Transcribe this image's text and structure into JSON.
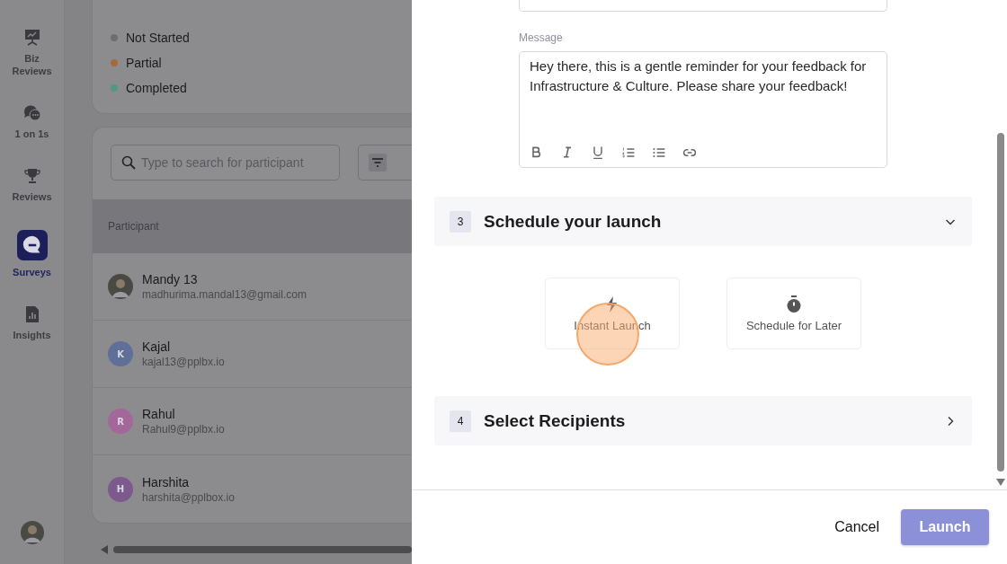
{
  "sidebar": {
    "items": [
      {
        "label": "Biz Reviews",
        "selected": false
      },
      {
        "label": "1 on 1s",
        "selected": false
      },
      {
        "label": "Reviews",
        "selected": false
      },
      {
        "label": "Surveys",
        "selected": true
      },
      {
        "label": "Insights",
        "selected": false
      }
    ]
  },
  "legend": [
    {
      "label": "Not Started",
      "color": "#6e6e72"
    },
    {
      "label": "Partial",
      "color": "#a8693a"
    },
    {
      "label": "Completed",
      "color": "#4f9a80"
    }
  ],
  "participants": {
    "search": {
      "placeholder": "Type to search for participant"
    },
    "columns": [
      "Participant"
    ],
    "rows": [
      {
        "name": "Mandy 13",
        "email": "madhurima.mandal13@gmail.com",
        "avatar": {
          "kind": "photo"
        }
      },
      {
        "name": "Kajal",
        "email": "kajal13@pplbx.io",
        "avatar": {
          "kind": "initial",
          "initial": "K",
          "color": "#5f6f98"
        }
      },
      {
        "name": "Rahul",
        "email": "Rahul9@pplbx.io",
        "avatar": {
          "kind": "initial",
          "initial": "R",
          "color": "#a3679a"
        }
      },
      {
        "name": "Harshita",
        "email": "harshita@pplbox.io",
        "avatar": {
          "kind": "initial",
          "initial": "H",
          "color": "#7d5a8e"
        }
      }
    ]
  },
  "drawer": {
    "message": {
      "label": "Message",
      "value": "Hey there, this is a gentle reminder for your feedback for Infrastructure & Culture. Please share your feedback!"
    },
    "sections": [
      {
        "number": "3",
        "title": "Schedule your launch",
        "expanded": true,
        "options": [
          {
            "label": "Instant Launch"
          },
          {
            "label": "Schedule for Later"
          }
        ]
      },
      {
        "number": "4",
        "title": "Select Recipients",
        "expanded": false
      }
    ],
    "buttons": [
      {
        "kind": "text",
        "label": "Cancel",
        "disabled": false
      },
      {
        "kind": "primary",
        "label": "Launch",
        "disabled": true
      }
    ]
  }
}
